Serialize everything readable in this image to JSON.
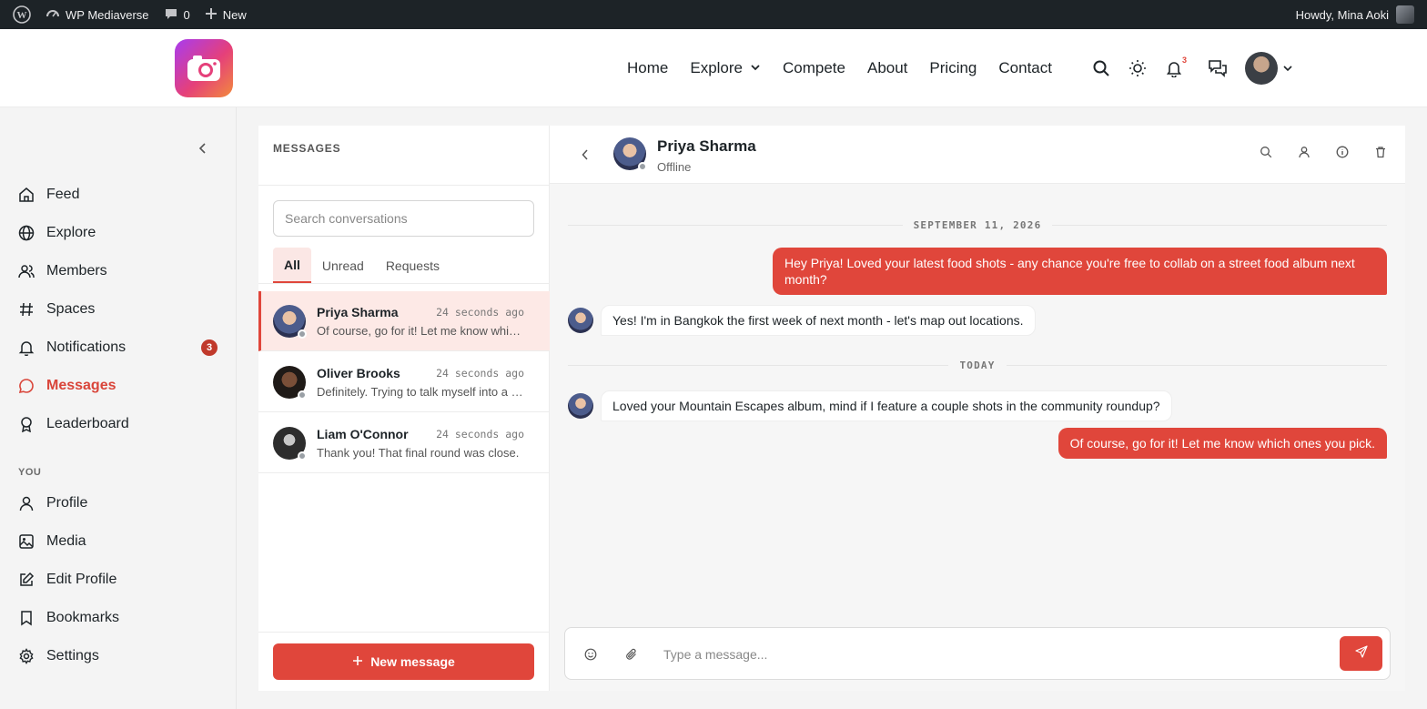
{
  "adminbar": {
    "site_name": "WP Mediaverse",
    "comments_count": "0",
    "new_label": "New",
    "howdy": "Howdy, Mina Aoki"
  },
  "header": {
    "nav": [
      {
        "label": "Home"
      },
      {
        "label": "Explore"
      },
      {
        "label": "Compete"
      },
      {
        "label": "About"
      },
      {
        "label": "Pricing"
      },
      {
        "label": "Contact"
      }
    ],
    "notification_count": "3"
  },
  "sidebar": {
    "items": [
      {
        "label": "Feed",
        "icon": "home-icon"
      },
      {
        "label": "Explore",
        "icon": "globe-icon"
      },
      {
        "label": "Members",
        "icon": "users-icon"
      },
      {
        "label": "Spaces",
        "icon": "hash-icon"
      },
      {
        "label": "Notifications",
        "icon": "bell-icon",
        "badge": "3"
      },
      {
        "label": "Messages",
        "icon": "message-icon",
        "active": true
      },
      {
        "label": "Leaderboard",
        "icon": "award-icon"
      }
    ],
    "section_you": "YOU",
    "you_items": [
      {
        "label": "Profile",
        "icon": "user-icon"
      },
      {
        "label": "Media",
        "icon": "image-icon"
      },
      {
        "label": "Edit Profile",
        "icon": "edit-icon"
      },
      {
        "label": "Bookmarks",
        "icon": "bookmark-icon"
      },
      {
        "label": "Settings",
        "icon": "gear-icon"
      }
    ]
  },
  "messages": {
    "title": "MESSAGES",
    "search_placeholder": "Search conversations",
    "tabs": [
      {
        "label": "All",
        "active": true
      },
      {
        "label": "Unread"
      },
      {
        "label": "Requests"
      }
    ],
    "conversations": [
      {
        "name": "Priya Sharma",
        "time": "24 seconds ago",
        "preview": "Of course, go for it! Let me know which ones you pick.",
        "active": true
      },
      {
        "name": "Oliver Brooks",
        "time": "24 seconds ago",
        "preview": "Definitely. Trying to talk myself into a last shoot this weekend."
      },
      {
        "name": "Liam O'Connor",
        "time": "24 seconds ago",
        "preview": "Thank you! That final round was close."
      }
    ],
    "new_message_label": "New message"
  },
  "chat": {
    "contact_name": "Priya Sharma",
    "contact_status": "Offline",
    "date_1": "SEPTEMBER 11, 2026",
    "msg_1_out": "Hey Priya! Loved your latest food shots - any chance you're free to collab on a street food album next month?",
    "msg_2_in": "Yes! I'm in Bangkok the first week of next month - let's map out locations.",
    "date_2": "TODAY",
    "msg_3_in": "Loved your Mountain Escapes album, mind if I feature a couple shots in the community roundup?",
    "msg_4_out": "Of course, go for it! Let me know which ones you pick.",
    "composer_placeholder": "Type a message..."
  },
  "colors": {
    "accent": "#e0463b",
    "active_row_bg": "#fde9e6",
    "adminbar_bg": "#1d2327"
  }
}
